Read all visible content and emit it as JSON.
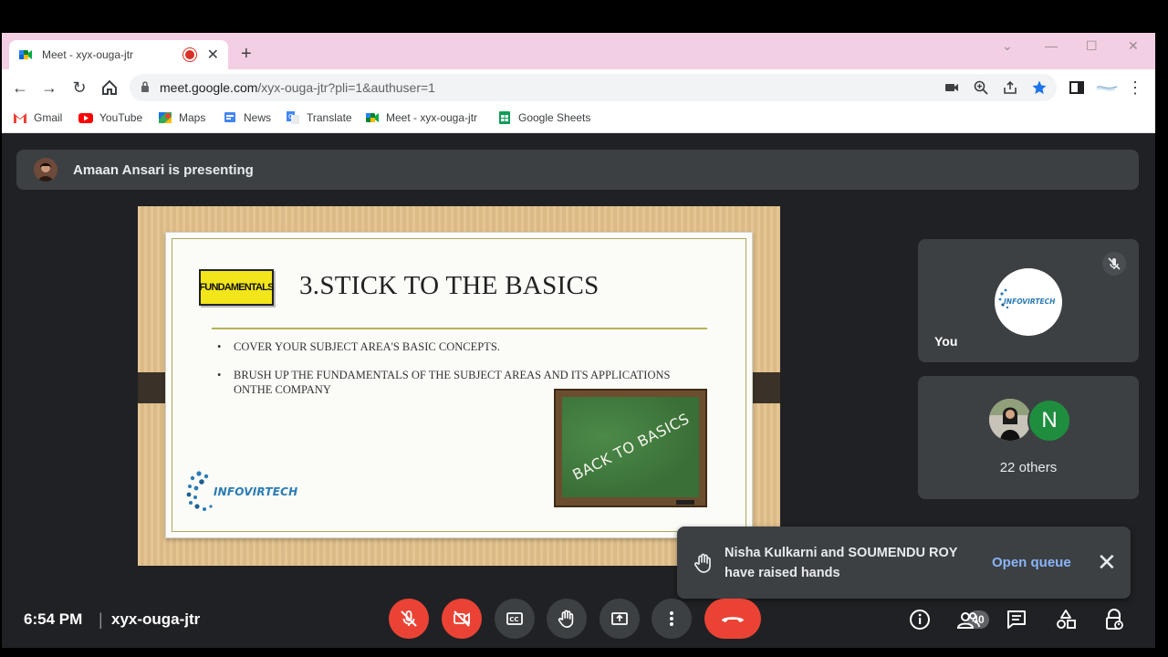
{
  "browser": {
    "tab_title": "Meet - xyx-ouga-jtr",
    "url_host": "meet.google.com",
    "url_path": "/xyx-ouga-jtr?pli=1&authuser=1",
    "bookmarks": [
      {
        "label": "Gmail",
        "icon": "gmail-icon"
      },
      {
        "label": "YouTube",
        "icon": "youtube-icon"
      },
      {
        "label": "Maps",
        "icon": "maps-icon"
      },
      {
        "label": "News",
        "icon": "news-icon"
      },
      {
        "label": "Translate",
        "icon": "translate-icon"
      },
      {
        "label": "Meet - xyx-ouga-jtr",
        "icon": "meet-icon"
      },
      {
        "label": "Google Sheets",
        "icon": "sheets-icon"
      }
    ]
  },
  "meet": {
    "presenting_text": "Amaan Ansari is presenting",
    "slide": {
      "tag": "FUNDAMENTALS",
      "title": "3.STICK TO THE BASICS",
      "bullets": [
        "COVER YOUR SUBJECT AREA'S BASIC CONCEPTS.",
        "BRUSH UP THE FUNDAMENTALS OF THE SUBJECT AREAS AND ITS APPLICATIONS ONTHE COMPANY"
      ],
      "chalkboard_text": "BACK TO BASICS",
      "logo_text": "INFOVIRTECH"
    },
    "self_tile": {
      "label": "You",
      "avatar_text": "INFOVIRTECH"
    },
    "others_tile": {
      "initial": "N",
      "label": "22 others"
    },
    "toast": {
      "message": "Nisha Kulkarni and SOUMENDU ROY have raised hands",
      "action": "Open queue"
    },
    "bottom": {
      "time": "6:54 PM",
      "separator": "|",
      "meeting_code": "xyx-ouga-jtr",
      "participants_count": "40"
    }
  },
  "colors": {
    "meet_bg": "#202124",
    "panel": "#3c4043",
    "red": "#ea4335",
    "link_blue": "#8ab4f8",
    "tabstrip": "#f3cfe3"
  }
}
